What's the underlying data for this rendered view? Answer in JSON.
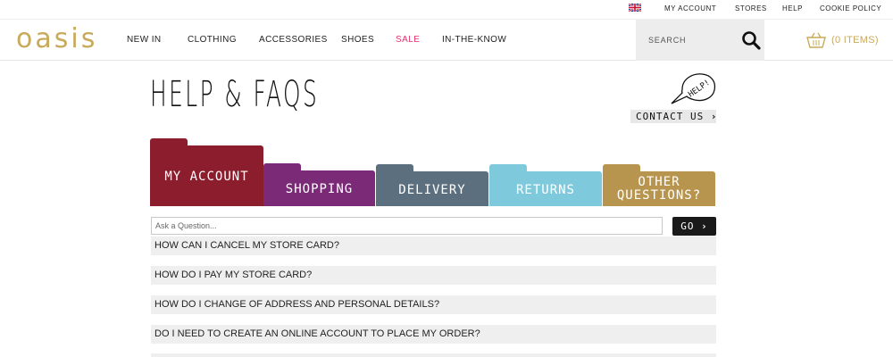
{
  "utility_bar": {
    "links": [
      "MY ACCOUNT",
      "STORES",
      "HELP",
      "COOKIE POLICY"
    ]
  },
  "header": {
    "logo": "oasis",
    "nav": [
      "NEW IN",
      "CLOTHING",
      "ACCESSORIES",
      "SHOES",
      "SALE",
      "IN-THE-KNOW"
    ],
    "search_placeholder": "SEARCH",
    "basket_label": "(0 ITEMS)",
    "brand_color": "#c9a95a",
    "sale_color": "#e0356d"
  },
  "help": {
    "title": "HELP & FAQS",
    "bubble_text": "HELP!",
    "contact_label": "CONTACT US"
  },
  "tabs": [
    {
      "label_lines": [
        "MY ACCOUNT"
      ],
      "color": "#8c1d2c",
      "active": true
    },
    {
      "label_lines": [
        "SHOPPING"
      ],
      "color": "#7a2a76"
    },
    {
      "label_lines": [
        "DELIVERY"
      ],
      "color": "#5c6f7e"
    },
    {
      "label_lines": [
        "RETURNS"
      ],
      "color": "#7fc9dc"
    },
    {
      "label_lines": [
        "OTHER",
        "QUESTIONS?"
      ],
      "color": "#b8954e"
    }
  ],
  "faq_search": {
    "placeholder": "Ask a Question...",
    "go_label": "GO"
  },
  "faqs": [
    "HOW CAN I CANCEL MY STORE CARD?",
    "HOW DO I PAY MY STORE CARD?",
    "HOW DO I CHANGE OF ADDRESS AND PERSONAL DETAILS?",
    "DO I NEED TO CREATE AN ONLINE ACCOUNT TO PLACE MY ORDER?"
  ]
}
